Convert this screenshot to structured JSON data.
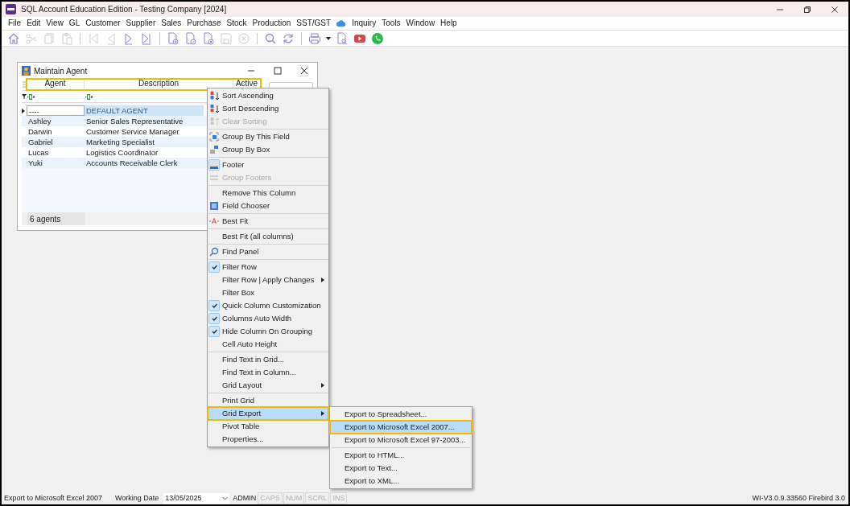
{
  "app_window": {
    "title": "SQL Account Education Edition - Testing Company [2024]"
  },
  "menu_bar": [
    {
      "label": "File"
    },
    {
      "label": "Edit"
    },
    {
      "label": "View"
    },
    {
      "label": "GL"
    },
    {
      "label": "Customer"
    },
    {
      "label": "Supplier"
    },
    {
      "label": "Sales"
    },
    {
      "label": "Purchase"
    },
    {
      "label": "Stock"
    },
    {
      "label": "Production"
    },
    {
      "label": "SST/GST"
    },
    {
      "label": "Inquiry"
    },
    {
      "label": "Tools"
    },
    {
      "label": "Window"
    },
    {
      "label": "Help"
    }
  ],
  "toolbar": [
    {
      "kind": "button",
      "disabled": false
    },
    {
      "kind": "button",
      "disabled": true
    },
    {
      "kind": "button",
      "disabled": true
    },
    {
      "kind": "button",
      "disabled": true
    },
    {
      "kind": "separator"
    },
    {
      "kind": "button",
      "disabled": true
    },
    {
      "kind": "button",
      "disabled": true
    },
    {
      "kind": "button",
      "disabled": false
    },
    {
      "kind": "button",
      "disabled": false
    },
    {
      "kind": "separator"
    },
    {
      "kind": "button",
      "disabled": false
    },
    {
      "kind": "button",
      "disabled": false
    },
    {
      "kind": "button",
      "disabled": false
    },
    {
      "kind": "button",
      "disabled": true
    },
    {
      "kind": "button",
      "disabled": true
    },
    {
      "kind": "separator"
    },
    {
      "kind": "button",
      "disabled": false
    },
    {
      "kind": "button",
      "disabled": false
    },
    {
      "kind": "separator"
    },
    {
      "kind": "button",
      "disabled": false
    },
    {
      "kind": "dropdown"
    },
    {
      "kind": "button",
      "disabled": false
    },
    {
      "kind": "button"
    },
    {
      "kind": "button"
    }
  ],
  "child_window": {
    "title": "Maintain Agent",
    "grid": {
      "header_highlighted": true,
      "columns": [
        {
          "label": "Agent"
        },
        {
          "label": "Description"
        },
        {
          "label": "Active"
        }
      ],
      "rows": [
        {
          "agent": "----",
          "description": "DEFAULT AGENT",
          "selected": true
        },
        {
          "agent": "Ashley",
          "description": "Senior Sales Representative",
          "selected": false
        },
        {
          "agent": "Darwin",
          "description": "Customer Service Manager",
          "selected": false
        },
        {
          "agent": "Gabriel",
          "description": "Marketing Specialist",
          "selected": false
        },
        {
          "agent": "Lucas",
          "description": "Logistics Coordinator",
          "selected": false
        },
        {
          "agent": "Yuki",
          "description": "Accounts Receivable Clerk",
          "selected": false
        }
      ],
      "footer": "6 agents"
    }
  },
  "context_menu": [
    {
      "kind": "item",
      "label": "Sort Ascending",
      "disabled": false,
      "checked": false
    },
    {
      "kind": "item",
      "label": "Sort Descending",
      "disabled": false,
      "checked": false
    },
    {
      "kind": "item",
      "label": "Clear Sorting",
      "disabled": true,
      "checked": false
    },
    {
      "kind": "separator"
    },
    {
      "kind": "item",
      "label": "Group By This Field",
      "disabled": false,
      "checked": false
    },
    {
      "kind": "item",
      "label": "Group By Box",
      "disabled": false,
      "checked": false
    },
    {
      "kind": "separator"
    },
    {
      "kind": "item",
      "label": "Footer",
      "disabled": false,
      "checked": true
    },
    {
      "kind": "item",
      "label": "Group Footers",
      "disabled": true,
      "checked": false
    },
    {
      "kind": "separator"
    },
    {
      "kind": "item",
      "label": "Remove This Column",
      "disabled": false,
      "checked": false
    },
    {
      "kind": "item",
      "label": "Field Chooser",
      "disabled": false,
      "checked": false
    },
    {
      "kind": "separator"
    },
    {
      "kind": "item",
      "label": "Best Fit",
      "disabled": false,
      "checked": false
    },
    {
      "kind": "separator"
    },
    {
      "kind": "item",
      "label": "Best Fit (all columns)",
      "disabled": false,
      "checked": false
    },
    {
      "kind": "separator"
    },
    {
      "kind": "item",
      "label": "Find Panel",
      "disabled": false,
      "checked": false
    },
    {
      "kind": "separator"
    },
    {
      "kind": "item",
      "label": "Filter Row",
      "disabled": false,
      "checked": true
    },
    {
      "kind": "submenu",
      "label": "Filter Row | Apply Changes",
      "selected": false
    },
    {
      "kind": "item",
      "label": "Filter Box",
      "disabled": false,
      "checked": false
    },
    {
      "kind": "item",
      "label": "Quick Column Customization",
      "disabled": false,
      "checked": true
    },
    {
      "kind": "item",
      "label": "Columns Auto Width",
      "disabled": false,
      "checked": true
    },
    {
      "kind": "item",
      "label": "Hide Column On Grouping",
      "disabled": false,
      "checked": true
    },
    {
      "kind": "item",
      "label": "Cell Auto Height",
      "disabled": false,
      "checked": false
    },
    {
      "kind": "separator"
    },
    {
      "kind": "item",
      "label": "Find Text in Grid...",
      "disabled": false,
      "checked": false
    },
    {
      "kind": "item",
      "label": "Find Text in Column...",
      "disabled": false,
      "checked": false
    },
    {
      "kind": "submenu",
      "label": "Grid Layout",
      "selected": false
    },
    {
      "kind": "separator"
    },
    {
      "kind": "item",
      "label": "Print Grid",
      "disabled": false,
      "checked": false
    },
    {
      "kind": "submenu",
      "label": "Grid Export",
      "selected": true,
      "highlighted": true,
      "items": [
        {
          "kind": "item",
          "label": "Export to Spreadsheet...",
          "selected": false,
          "highlighted": false
        },
        {
          "kind": "item",
          "label": "Export to Microsoft Excel 2007...",
          "selected": true,
          "highlighted": true
        },
        {
          "kind": "item",
          "label": "Export to Microsoft Excel 97-2003...",
          "selected": false,
          "highlighted": false
        },
        {
          "kind": "separator"
        },
        {
          "kind": "item",
          "label": "Export to HTML...",
          "selected": false,
          "highlighted": false
        },
        {
          "kind": "item",
          "label": "Export to Text...",
          "selected": false,
          "highlighted": false
        },
        {
          "kind": "item",
          "label": "Export to XML...",
          "selected": false,
          "highlighted": false
        }
      ]
    },
    {
      "kind": "item",
      "label": "Pivot Table",
      "disabled": false,
      "checked": false
    },
    {
      "kind": "item",
      "label": "Properties...",
      "disabled": false,
      "checked": false
    }
  ],
  "status_bar": {
    "hint": "Export to Microsoft Excel 2007",
    "working_date_label": "Working Date",
    "working_date": "13/05/2025",
    "user": "ADMIN",
    "keys": [
      {
        "label": "CAPS",
        "on": false
      },
      {
        "label": "NUM",
        "on": false
      },
      {
        "label": "SCRL",
        "on": false
      },
      {
        "label": "INS",
        "on": false
      }
    ],
    "version": "WI-V3.0.9.33560 Firebird 3.0"
  }
}
